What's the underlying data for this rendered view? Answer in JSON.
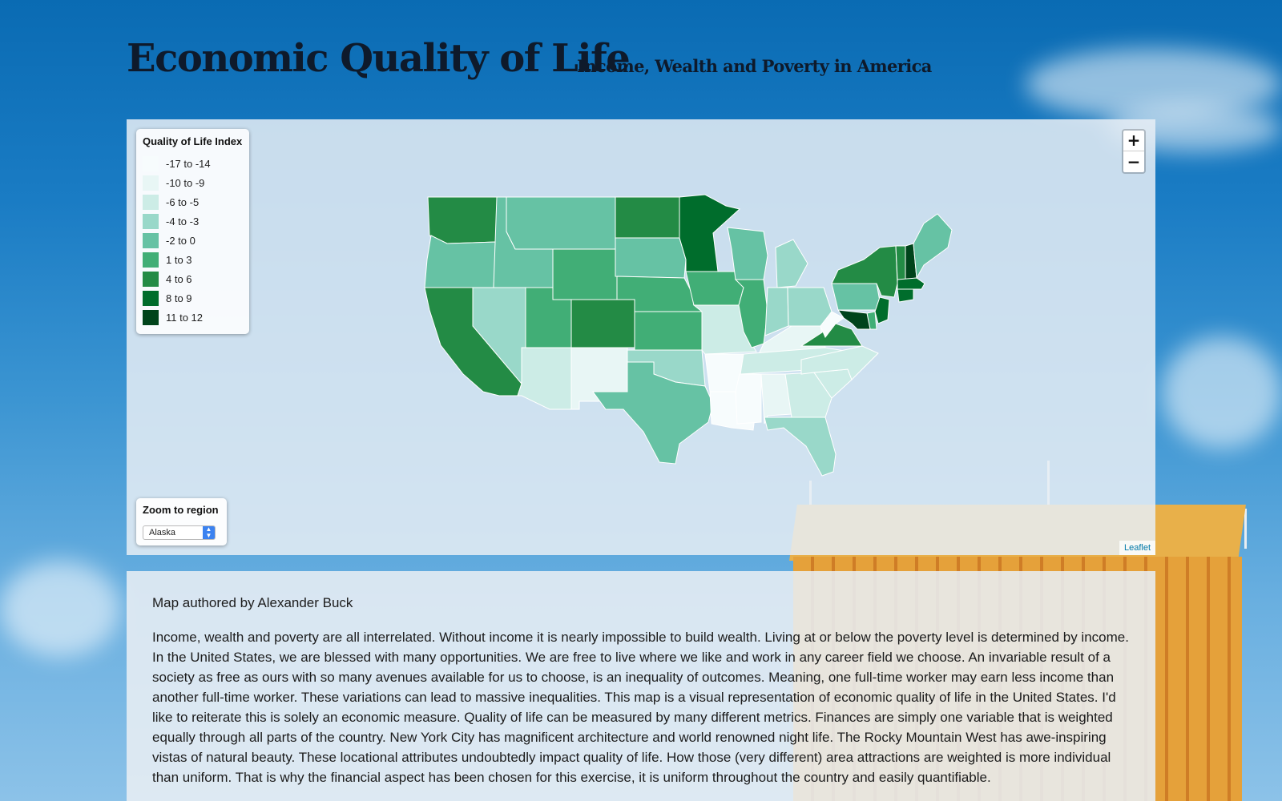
{
  "header": {
    "title": "Economic Quality of Life",
    "subtitle": "Income, Wealth and Poverty in America"
  },
  "map": {
    "legend": {
      "title": "Quality of Life Index",
      "items": [
        {
          "label": "-17 to -14",
          "color": "#f7fcfd"
        },
        {
          "label": "-10 to -9",
          "color": "#e8f6f5"
        },
        {
          "label": "-6 to -5",
          "color": "#ccece6"
        },
        {
          "label": "-4 to -3",
          "color": "#99d8c9"
        },
        {
          "label": "-2 to 0",
          "color": "#66c2a4"
        },
        {
          "label": "1 to 3",
          "color": "#41ae76"
        },
        {
          "label": "4 to 6",
          "color": "#238b45"
        },
        {
          "label": "8 to 9",
          "color": "#006d2c"
        },
        {
          "label": "11 to 12",
          "color": "#00441b"
        }
      ]
    },
    "zoom": {
      "in_label": "+",
      "out_label": "−"
    },
    "region": {
      "title": "Zoom to region",
      "selected": "Alaska"
    },
    "attribution": "Leaflet",
    "region_colors": {
      "WA": "#238b45",
      "OR": "#66c2a4",
      "CA": "#238b45",
      "NV": "#99d8c9",
      "ID": "#66c2a4",
      "MT": "#66c2a4",
      "WY": "#41ae76",
      "UT": "#41ae76",
      "AZ": "#ccece6",
      "CO": "#238b45",
      "NM": "#e8f6f5",
      "ND": "#238b45",
      "SD": "#66c2a4",
      "NE": "#41ae76",
      "KS": "#41ae76",
      "OK": "#99d8c9",
      "TX": "#66c2a4",
      "MN": "#006d2c",
      "IA": "#41ae76",
      "MO": "#ccece6",
      "AR": "#f7fcfd",
      "LA": "#f7fcfd",
      "WI": "#66c2a4",
      "IL": "#41ae76",
      "MI": "#99d8c9",
      "IN": "#99d8c9",
      "OH": "#99d8c9",
      "KY": "#e8f6f5",
      "TN": "#ccece6",
      "MS": "#f7fcfd",
      "AL": "#e8f6f5",
      "GA": "#ccece6",
      "FL": "#99d8c9",
      "SC": "#ccece6",
      "NC": "#ccece6",
      "VA": "#238b45",
      "WV": "#f7fcfd",
      "PA": "#66c2a4",
      "NY": "#238b45",
      "VT": "#238b45",
      "NH": "#00441b",
      "ME": "#66c2a4",
      "MA": "#006d2c",
      "CT": "#006d2c",
      "NJ": "#006d2c",
      "DE": "#41ae76",
      "MD": "#00441b"
    }
  },
  "info": {
    "author": "Map authored by Alexander Buck",
    "body": "Income, wealth and poverty are all interrelated. Without income it is nearly impossible to build wealth. Living at or below the poverty level is determined by income. In the United States, we are blessed with many opportunities. We are free to live where we like and work in any career field we choose. An invariable result of a society as free as ours with so many avenues available for us to choose, is an inequality of outcomes. Meaning, one full-time worker may earn less income than another full-time worker. These variations can lead to massive inequalities. This map is a visual representation of economic quality of life in the United States. I'd like to reiterate this is solely an economic measure. Quality of life can be measured by many different metrics. Finances are simply one variable that is weighted equally through all parts of the country. New York City has magnificent architecture and world renowned night life. The Rocky Mountain West has awe-inspiring vistas of natural beauty. These locational attributes undoubtedly impact quality of life. How those (very different) area attractions are weighted is more individual than uniform. That is why the financial aspect has been chosen for this exercise, it is uniform throughout the country and easily quantifiable."
  }
}
